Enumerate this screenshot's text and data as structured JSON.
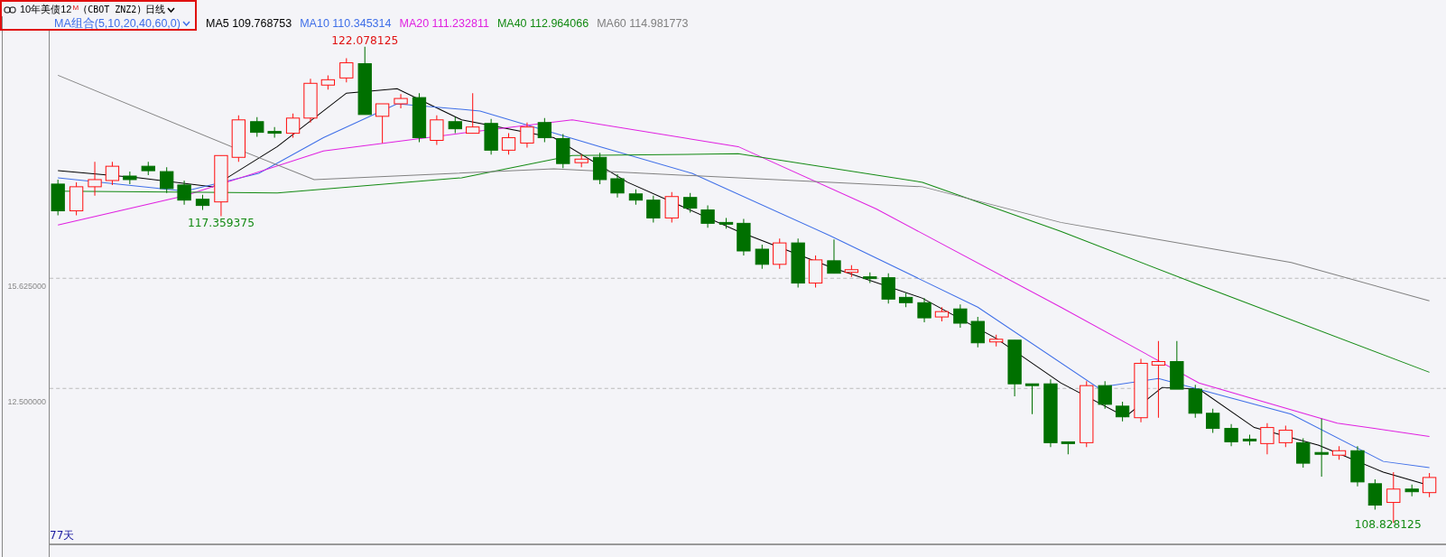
{
  "instrument": {
    "name": "10年美债12",
    "flag": "M",
    "code": "(CBOT ZNZ2)"
  },
  "period": "日线",
  "indicator": "MA组合(5,10,20,40,60,0)",
  "ma_values": [
    {
      "label": "MA5",
      "value": "109.768753",
      "color": "#000000"
    },
    {
      "label": "MA10",
      "value": "110.345314",
      "color": "#3f6fe8"
    },
    {
      "label": "MA20",
      "value": "111.232811",
      "color": "#e020e0"
    },
    {
      "label": "MA40",
      "value": "112.964066",
      "color": "#138a13"
    },
    {
      "label": "MA60",
      "value": "114.981773",
      "color": "#808080"
    }
  ],
  "price_axis": [
    "15.625000",
    "12.500000"
  ],
  "extreme_labels": [
    {
      "text": "122.078125",
      "kind": "high"
    },
    {
      "text": "117.359375",
      "kind": "low"
    },
    {
      "text": "108.828125",
      "kind": "low"
    }
  ],
  "day_count": "77天"
}
